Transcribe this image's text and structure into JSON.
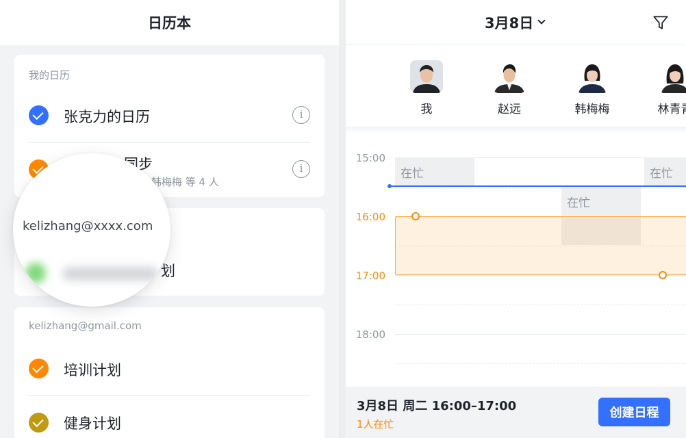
{
  "left_panel": {
    "title": "日历本",
    "my_calendars": {
      "label": "我的日历",
      "items": [
        {
          "label": "张克力的日历",
          "color": "#3370ff",
          "checked": true,
          "info_icon": "info-icon"
        },
        {
          "label": "同步",
          "subtitle": "韩梅梅 等 4 人",
          "color": "#ff8800",
          "checked": true,
          "info_icon": "info-icon"
        }
      ]
    },
    "account_card": {
      "item": {
        "label": "划",
        "color": "#34c724",
        "checked": true
      }
    },
    "magnifier": {
      "email": "kelizhang@xxxx.com"
    },
    "gmail_calendars": {
      "label": "kelizhang@gmail.com",
      "items": [
        {
          "label": "培训计划",
          "color": "#ff8800",
          "checked": true
        },
        {
          "label": "健身计划",
          "color": "#c09a0f",
          "checked": true
        }
      ]
    }
  },
  "right_panel": {
    "date_picker": {
      "label": "3月8日",
      "icon": "chevron-down-icon"
    },
    "filter_icon": "filter-icon",
    "people": [
      {
        "name": "我"
      },
      {
        "name": "赵远"
      },
      {
        "name": "韩梅梅"
      },
      {
        "name": "林青青"
      }
    ],
    "timeline": {
      "times": [
        "15:00",
        "16:00",
        "17:00",
        "18:00"
      ],
      "busy_label": "在忙"
    },
    "footer": {
      "time_range": "3月8日 周二 16:00–17:00",
      "busy_count": "1人在忙",
      "create_button": "创建日程"
    }
  },
  "colors": {
    "accent_blue": "#3370ff",
    "selection_orange": "#ff8800",
    "busy_gray": "#eeeff1"
  }
}
